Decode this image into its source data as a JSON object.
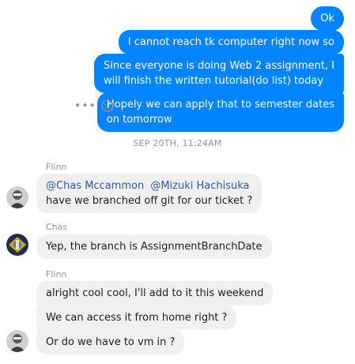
{
  "outgoing": [
    {
      "text": "Ok"
    },
    {
      "text": "I cannot reach tk computer right now so"
    },
    {
      "line1": "Since everyone is doing Web 2 assignment, I",
      "line2": "will finish the written tutorial(do list) today"
    },
    {
      "line1": "Hopely we can apply that to semester dates",
      "line2": "on tomorrow"
    }
  ],
  "timestamp": "SEP 20TH, 11:24AM",
  "groups": [
    {
      "sender": "Flinn",
      "mention1": "@Chas Mccammon",
      "mention2": "@Mizuki Hachisuka",
      "text": "have we branched off git for our ticket ?"
    },
    {
      "sender": "Chas",
      "text": "Yep, the branch is AssignmentBranchDate"
    },
    {
      "sender": "Flinn",
      "messages": [
        "alright cool cool, I'll add to it this weekend",
        "We can access it from home right ?",
        "Or do we have to vm in ?"
      ]
    }
  ],
  "icons": {
    "more": "more-options-icon",
    "emoji": "emoji-icon"
  },
  "colors": {
    "outgoing_bubble": "#0084ff",
    "incoming_bubble": "#f1f0f0",
    "mention": "#365899",
    "meta_text": "#90949c"
  }
}
